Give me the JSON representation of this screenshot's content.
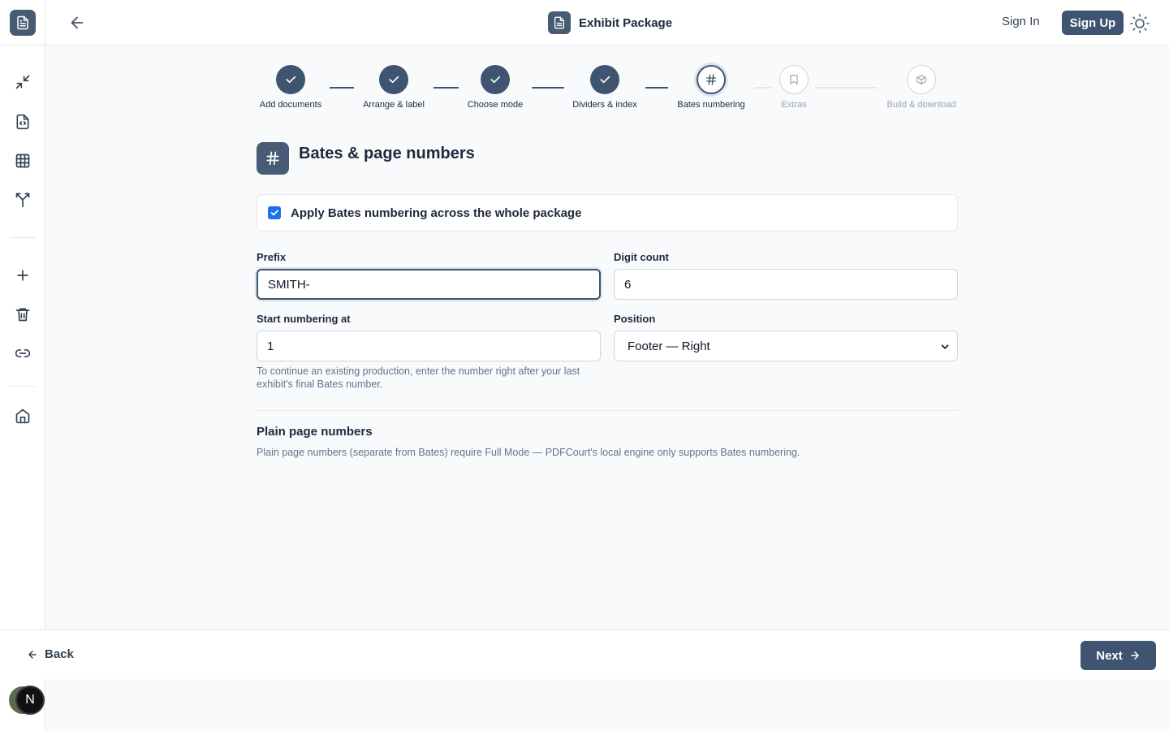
{
  "app": {
    "title": "Exhibit Package",
    "logo_icon": "document-icon"
  },
  "header": {
    "back_icon": "arrow-left-icon",
    "sign_in": "Sign In",
    "sign_up": "Sign Up",
    "theme_icon": "sun-icon"
  },
  "sidebar": {
    "items": [
      {
        "name": "compress-icon"
      },
      {
        "name": "file-code-icon"
      },
      {
        "name": "table-icon"
      },
      {
        "name": "split-icon"
      },
      {
        "name": "plus-icon"
      },
      {
        "name": "trash-icon"
      },
      {
        "name": "link-icon"
      },
      {
        "name": "home-icon"
      }
    ],
    "avatar_initial": "N"
  },
  "stepper": {
    "steps": [
      {
        "label": "Add documents",
        "status": "done"
      },
      {
        "label": "Arrange & label",
        "status": "done"
      },
      {
        "label": "Choose mode",
        "status": "done"
      },
      {
        "label": "Dividers & index",
        "status": "done"
      },
      {
        "label": "Bates numbering",
        "status": "active"
      },
      {
        "label": "Extras",
        "status": "todo"
      },
      {
        "label": "Build & download",
        "status": "todo"
      }
    ]
  },
  "section": {
    "title": "Bates & page numbers",
    "icon": "hash-icon"
  },
  "apply_bates": {
    "label": "Apply Bates numbering across the whole package",
    "checked": true
  },
  "fields": {
    "prefix": {
      "label": "Prefix",
      "value": "SMITH-"
    },
    "digit_count": {
      "label": "Digit count",
      "value": "6"
    },
    "start_at": {
      "label": "Start numbering at",
      "value": "1",
      "help": "To continue an existing production, enter the number right after your last exhibit's final Bates number."
    },
    "position": {
      "label": "Position",
      "value": "Footer — Right"
    }
  },
  "plain_numbers": {
    "title": "Plain page numbers",
    "text": "Plain page numbers (separate from Bates) require Full Mode — PDFCourt's local engine only supports Bates numbering."
  },
  "footer": {
    "back": "Back",
    "next": "Next"
  },
  "colors": {
    "primary": "#3e5470",
    "checkbox": "#1a73e8",
    "muted": "#64748b"
  }
}
